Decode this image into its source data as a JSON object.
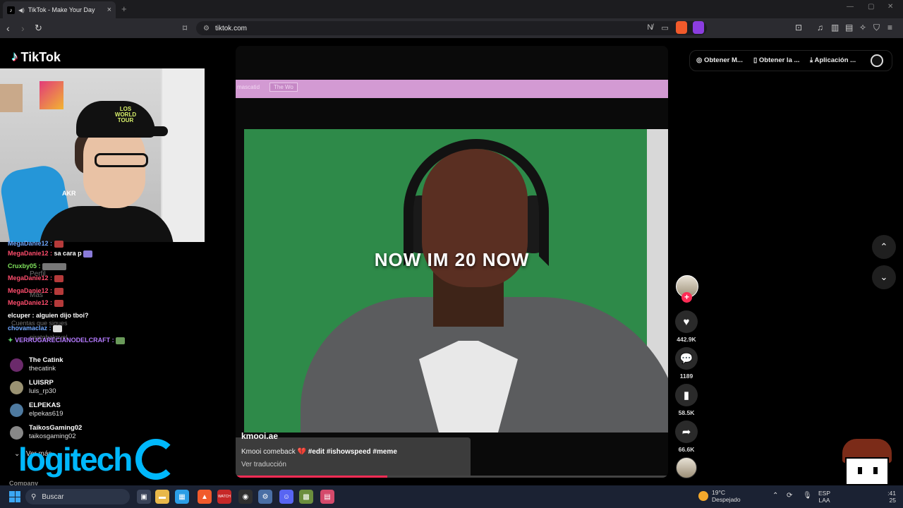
{
  "browser": {
    "tab_title": "TikTok - Make Your Day",
    "tab_close": "×",
    "new_tab": "+",
    "url": "tiktok.com",
    "brave_badge": "4",
    "alert_badge": "1"
  },
  "app": {
    "logo_text": "TikTok",
    "logo_glyph": "♪"
  },
  "webcam": {
    "cap_text": "LOS WORLD TOUR",
    "chair_brand": "AKR"
  },
  "sidebar": {
    "ghost_items": [
      "Perfil",
      "Más",
      "Cuentas que sigues",
      "piratobakpvel"
    ],
    "chat": [
      {
        "user": "MegaDanie12 :",
        "msg": "",
        "color": "#ff4d6d",
        "emote": true
      },
      {
        "user": "Cruxby05 :",
        "msg": "",
        "color": "#7fe25c",
        "emote": true
      },
      {
        "user": "MegaDanie12 :",
        "msg": "",
        "color": "#ff4d6d",
        "emote": true
      },
      {
        "user": "MegaDanie12 :",
        "msg": "",
        "color": "#ff4d6d",
        "emote": true
      },
      {
        "user": "MegaDanie12 :",
        "msg": "",
        "color": "#ff4d6d",
        "emote": true
      },
      {
        "user": "elcuper :",
        "msg": "alguien dijo tboi?",
        "color": "#ffffff",
        "emote": false
      },
      {
        "user": "chovamaclaz :",
        "msg": "",
        "color": "#6fa8ff",
        "emote": true
      },
      {
        "user": "VERRUGARECIANODELCRAFT :",
        "msg": "",
        "color": "#b57bff",
        "emote": true
      }
    ],
    "chat_partial": "sa cara p",
    "following": [
      {
        "name": "The Catink",
        "handle": "thecatink"
      },
      {
        "name": "LUISRP",
        "handle": "luis_rp30"
      },
      {
        "name": "ELPEKAS",
        "handle": "elpekas619"
      },
      {
        "name": "TaikosGaming02",
        "handle": "taikosgaming02"
      }
    ],
    "ver_mas": "Ver más",
    "company": "Company"
  },
  "sponsor": {
    "brand": "logitech"
  },
  "video": {
    "top_text_left": "mascatid",
    "top_button": "The Wo",
    "caption": "NOW IM 20 NOW",
    "author": "kmooi.ae",
    "description": "Kmooi comeback",
    "hashtags": "#edit #ishowspeed #meme",
    "translate": "Ver traducción",
    "progress": 0.35
  },
  "actions": {
    "likes": "442.9K",
    "comments": "1189",
    "saves": "58.5K",
    "shares": "66.6K"
  },
  "header": {
    "get_coins": "Obtener M...",
    "get_app": "Obtener la ...",
    "download_app": "Aplicación ..."
  },
  "sprite": {
    "shirt_text": "AC"
  },
  "taskbar": {
    "search_placeholder": "Buscar",
    "weather_temp": "19°C",
    "weather_desc": "Despejado",
    "lang_top": "ESP",
    "lang_bottom": "LAA",
    "time": ":41",
    "date": "25",
    "youtube_label": "WATCH"
  },
  "colors": {
    "accent": "#fe2c55",
    "logitech": "#00b8fc"
  }
}
